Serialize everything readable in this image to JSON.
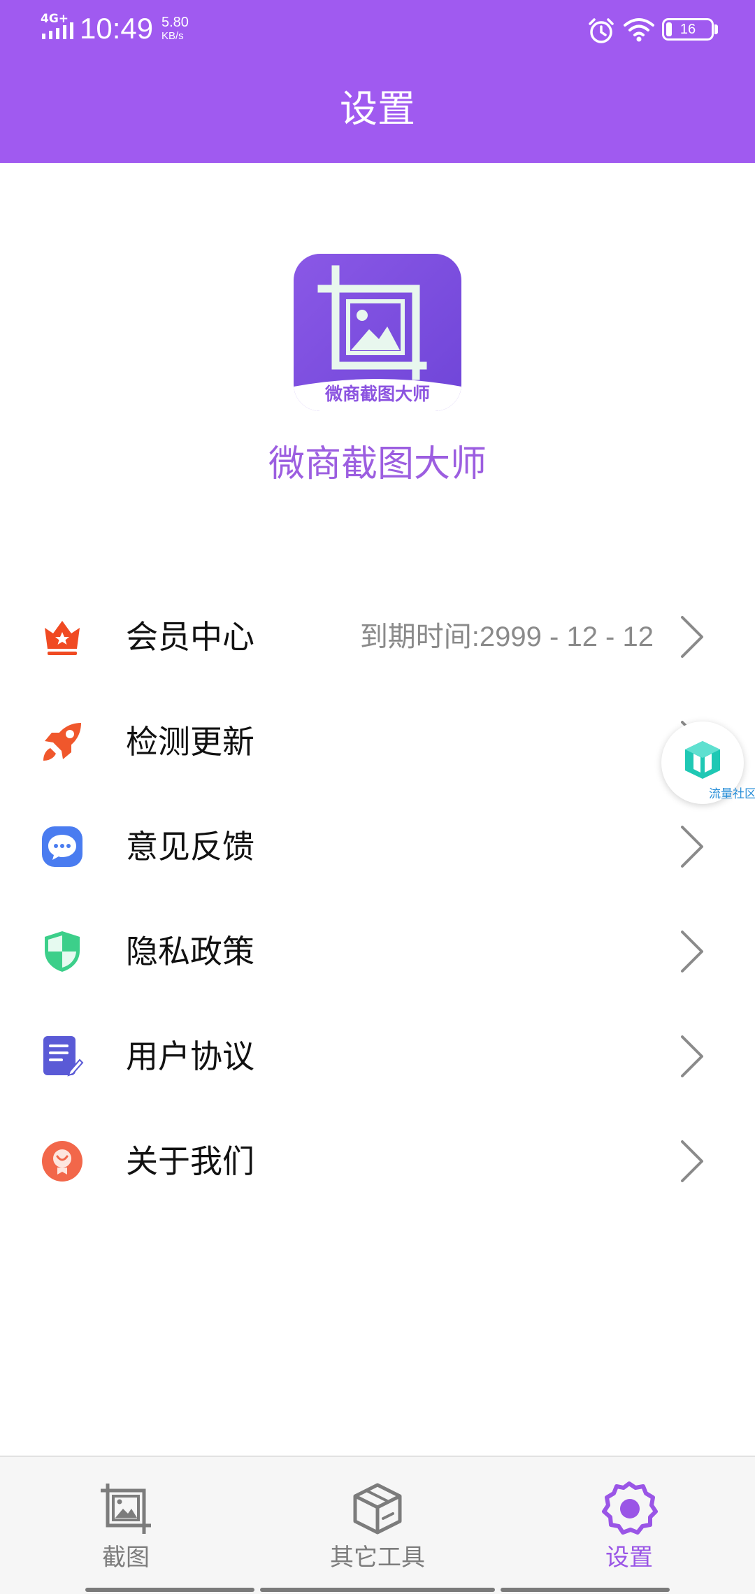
{
  "status_bar": {
    "network": "4G+",
    "time": "10:49",
    "speed_value": "5.80",
    "speed_unit": "KB/s",
    "battery": "16",
    "icons": [
      "signal-icon",
      "alarm-icon",
      "wifi-icon",
      "battery-icon"
    ]
  },
  "header": {
    "title": "设置",
    "background_color": "#a05af0"
  },
  "app": {
    "logo_caption": "微商截图大师",
    "name": "微商截图大师"
  },
  "menu": {
    "items": [
      {
        "label": "会员中心",
        "value": "到期时间:2999 - 12 - 12",
        "icon": "crown-icon"
      },
      {
        "label": "检测更新",
        "value": "",
        "icon": "rocket-icon"
      },
      {
        "label": "意见反馈",
        "value": "",
        "icon": "chat-icon"
      },
      {
        "label": "隐私政策",
        "value": "",
        "icon": "shield-icon"
      },
      {
        "label": "用户协议",
        "value": "",
        "icon": "document-icon"
      },
      {
        "label": "关于我们",
        "value": "",
        "icon": "info-person-icon"
      }
    ]
  },
  "floating_bubble": {
    "label": "流量社区",
    "icon": "cube-icon"
  },
  "bottom_nav": {
    "items": [
      {
        "label": "截图",
        "icon": "crop-image-icon",
        "active": false
      },
      {
        "label": "其它工具",
        "icon": "box-icon",
        "active": false
      },
      {
        "label": "设置",
        "icon": "gear-icon",
        "active": true
      }
    ],
    "active_color": "#9a55e6",
    "inactive_color": "#7c7c7c"
  }
}
